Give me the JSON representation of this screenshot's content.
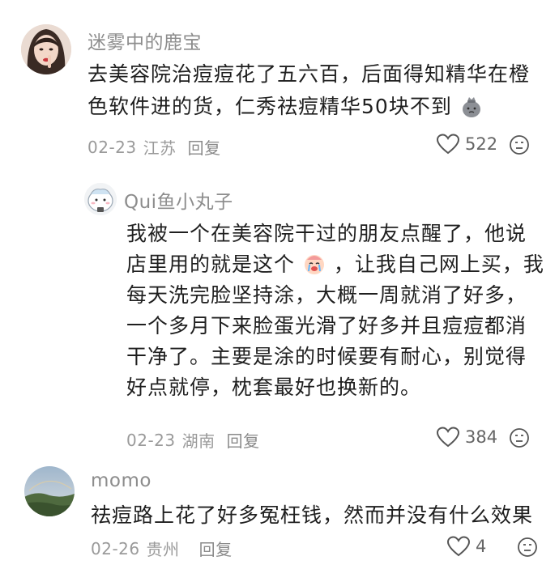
{
  "comments": [
    {
      "username": "迷雾中的鹿宝",
      "text_line1": "去美容院治痘痘花了五六百，后面得知精华在橙",
      "text_line2": "色软件进的货，仁秀祛痘精华50块不到",
      "date": "02-23",
      "location": "江苏",
      "reply_label": "回复",
      "likes": "522"
    },
    {
      "username": "Qui鱼小丸子",
      "lines": [
        "我被一个在美容院干过的朋友点醒了，他说",
        "店里用的就是这个",
        "，让我自己网上买，我",
        "每天洗完脸坚持涂，大概一周就消了好多，",
        "一个多月下来脸蛋光滑了好多并且痘痘都消",
        "干净了。主要是涂的时候要有耐心，别觉得",
        "好点就停，枕套最好也换新的。"
      ],
      "date": "02-23",
      "location": "湖南",
      "reply_label": "回复",
      "likes": "384"
    },
    {
      "username": "momo",
      "text": "祛痘路上花了好多冤枉钱，然而并没有什么效果",
      "date": "02-26",
      "location": "贵州",
      "reply_label": "回复",
      "likes": "4"
    }
  ]
}
